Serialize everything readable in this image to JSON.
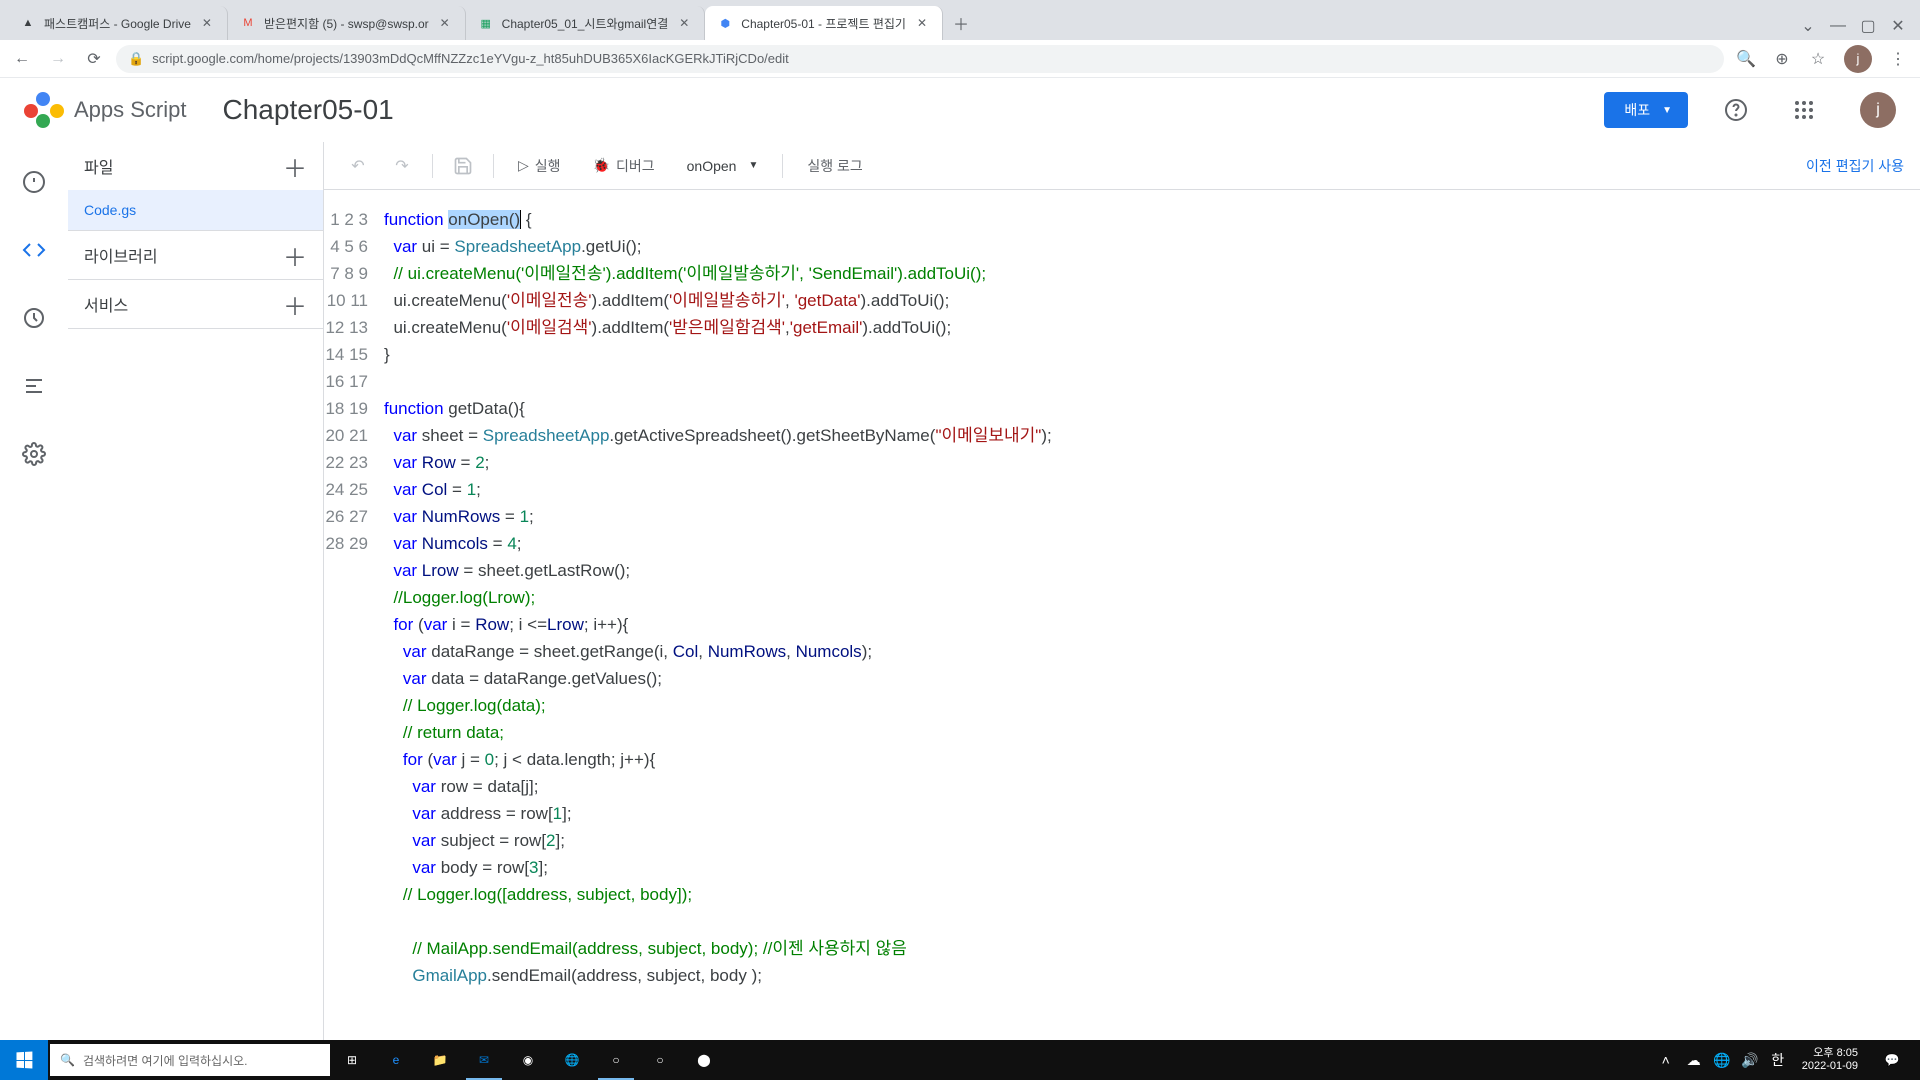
{
  "tabs": [
    {
      "title": "패스트캠퍼스 - Google Drive",
      "favicon_color": "#0f9d58"
    },
    {
      "title": "받은편지함 (5) - swsp@swsp.or",
      "favicon_color": "#ea4335"
    },
    {
      "title": "Chapter05_01_시트와gmail연결",
      "favicon_color": "#0f9d58"
    },
    {
      "title": "Chapter05-01 - 프로젝트 편집기",
      "favicon_color": "#4285f4",
      "active": true
    }
  ],
  "url": "script.google.com/home/projects/13903mDdQcMffNZZzc1eYVgu-z_ht85uhDUB365X6IacKGERkJTiRjCDo/edit",
  "product_name": "Apps Script",
  "project_title": "Chapter05-01",
  "deploy_label": "배포",
  "header_avatar": "j",
  "side_panel": {
    "files_label": "파일",
    "file_item": "Code.gs",
    "libraries_label": "라이브러리",
    "services_label": "서비스"
  },
  "toolbar": {
    "run_label": "실행",
    "debug_label": "디버그",
    "function_selected": "onOpen",
    "log_label": "실행 로그",
    "legacy_label": "이전 편집기 사용"
  },
  "code_lines": 29,
  "code_tokens": {
    "l1": {
      "kw": "function",
      "sel": "onOpen()",
      "end": " {"
    },
    "l2": {
      "indent": "  ",
      "kw": "var",
      "v": " ui = ",
      "cls": "SpreadsheetApp",
      "rest": ".getUi();"
    },
    "l3": {
      "indent": "  ",
      "com": "// ui.createMenu('이메일전송').addItem('이메일발송하기', 'SendEmail').addToUi();"
    },
    "l4": {
      "indent": "  ",
      "pre": "ui.createMenu(",
      "s1": "'이메일전송'",
      "mid1": ").addItem(",
      "s2": "'이메일발송하기'",
      "mid2": ", ",
      "s3": "'getData'",
      "end": ").addToUi();"
    },
    "l5": {
      "indent": "  ",
      "pre": "ui.createMenu(",
      "s1": "'이메일검색'",
      "mid1": ").addItem(",
      "s2": "'받은메일함검색'",
      "mid2": ",",
      "s3": "'getEmail'",
      "end": ").addToUi();"
    },
    "l6": "}",
    "l7": "",
    "l8": {
      "kw": "function",
      "fn": " getData",
      "end": "(){"
    },
    "l9": {
      "indent": "  ",
      "kw": "var",
      "v": " sheet = ",
      "cls": "SpreadsheetApp",
      "mid": ".getActiveSpreadsheet().getSheetByName(",
      "str": "\"이메일보내기\"",
      "end": ");"
    },
    "l10": {
      "indent": "  ",
      "kw": "var",
      "v": " Row",
      "eq": " = ",
      "num": "2",
      "end": ";"
    },
    "l11": {
      "indent": "  ",
      "kw": "var",
      "v": " Col",
      "eq": " = ",
      "num": "1",
      "end": ";"
    },
    "l12": {
      "indent": "  ",
      "kw": "var",
      "v": " NumRows",
      "eq": " = ",
      "num": "1",
      "end": ";"
    },
    "l13": {
      "indent": "  ",
      "kw": "var",
      "v": " Numcols",
      "eq": " = ",
      "num": "4",
      "end": ";"
    },
    "l14": {
      "indent": "  ",
      "kw": "var",
      "v": " Lrow",
      "eq": " = sheet.getLastRow();"
    },
    "l15": {
      "indent": "  ",
      "com": "//Logger.log(Lrow);"
    },
    "l16": {
      "indent": "  ",
      "kw": "for",
      "p1": " (",
      "kw2": "var",
      "p2": " i = ",
      "var1": "Row",
      "p3": "; i <=",
      "var2": "Lrow",
      "p4": "; i++){"
    },
    "l17": {
      "indent": "    ",
      "kw": "var",
      "p1": " dataRange = sheet.getRange(i, ",
      "v1": "Col",
      "p2": ", ",
      "v2": "NumRows",
      "p3": ", ",
      "v3": "Numcols",
      "end": ");"
    },
    "l18": {
      "indent": "    ",
      "kw": "var",
      "rest": " data = dataRange.getValues();"
    },
    "l19": {
      "indent": "    ",
      "com": "// Logger.log(data);"
    },
    "l20": {
      "indent": "    ",
      "com": "// return data;"
    },
    "l21": {
      "indent": "    ",
      "kw": "for",
      "p1": " (",
      "kw2": "var",
      "p2": " j = ",
      "num": "0",
      "p3": "; j < data.length; j++){"
    },
    "l22": {
      "indent": "      ",
      "kw": "var",
      "rest": " row = data[j];"
    },
    "l23": {
      "indent": "      ",
      "kw": "var",
      "p1": " address = row[",
      "num": "1",
      "end": "];"
    },
    "l24": {
      "indent": "      ",
      "kw": "var",
      "p1": " subject = row[",
      "num": "2",
      "end": "];"
    },
    "l25": {
      "indent": "      ",
      "kw": "var",
      "p1": " body = row[",
      "num": "3",
      "end": "];"
    },
    "l26": {
      "indent": "    ",
      "com": "// Logger.log([address, subject, body]);"
    },
    "l27": "",
    "l28": {
      "indent": "      ",
      "com": "// MailApp.sendEmail(address, subject, body); //이젠 사용하지 않음"
    },
    "l29": {
      "indent": "      ",
      "cls": "GmailApp",
      "rest": ".sendEmail(address, subject, body );"
    }
  },
  "taskbar": {
    "search_placeholder": "검색하려면 여기에 입력하십시오.",
    "time": "오후 8:05",
    "date": "2022-01-09"
  }
}
